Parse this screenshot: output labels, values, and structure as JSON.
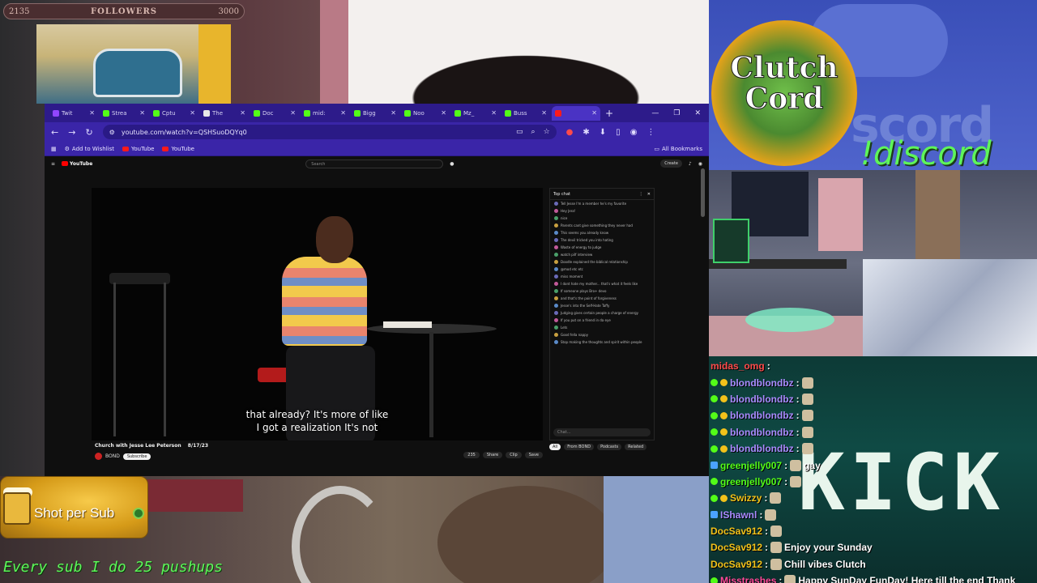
{
  "followers": {
    "current": "2135",
    "label": "FOLLOWERS",
    "goal": "3000"
  },
  "browser": {
    "tabs": [
      {
        "label": "Twit",
        "icon": "twitch-icon"
      },
      {
        "label": "Strea",
        "icon": "kick-icon"
      },
      {
        "label": "Cptu",
        "icon": "kick-icon"
      },
      {
        "label": "The",
        "icon": "shield-icon"
      },
      {
        "label": "Doc",
        "icon": "kick-icon"
      },
      {
        "label": "mid:",
        "icon": "kick-icon"
      },
      {
        "label": "Bigg",
        "icon": "kick-icon"
      },
      {
        "label": "Noo",
        "icon": "kick-icon"
      },
      {
        "label": "Mz_",
        "icon": "kick-icon"
      },
      {
        "label": "Buss",
        "icon": "kick-icon"
      },
      {
        "label": "",
        "icon": "youtube-icon"
      }
    ],
    "url": "youtube.com/watch?v=QSHSuoDQYq0",
    "bookmarks": [
      "Add to Wishlist",
      "YouTube",
      "YouTube"
    ],
    "all_bookmarks": "All Bookmarks"
  },
  "youtube": {
    "logo": "YouTube",
    "search_placeholder": "Search",
    "create": "Create",
    "subtitle_line1": "that already? It's more of like",
    "subtitle_line2": "I got a realization It's not",
    "video_title": "Church with Jesse Lee Peterson",
    "video_date": "8/17/23",
    "channel": "BOND",
    "subscribe": "Subscribe",
    "actions": [
      "235",
      "Share",
      "Clip",
      "Save"
    ],
    "chat_title": "Top chat",
    "chat_placeholder": "Chat...",
    "chips": [
      "All",
      "From BOND",
      "Podcasts",
      "Related"
    ],
    "chat_messages": [
      "Tell Jesse I'm a member he's my favorite",
      "Hey Jess!",
      "nice",
      "Parents cant give something they never had",
      "This seems you already know",
      "The devil tricked you into hating",
      "Waste of energy to judge",
      "watch pilf interview",
      "Doodle explained the biblical relationship",
      "@mod etc etc",
      "miss moment",
      "I dont hate my mother... that's what it feels like",
      "If someone plays Bro+ devo",
      "and that's the point of forgiveness",
      "Jesse's into the Self-Hate Taffy",
      "Judging gives certain people a charge of energy",
      "If you put on a friend in da eye",
      "Lets",
      "Good fella nappy",
      "Stop making the thoughts and spirit within people"
    ]
  },
  "discord": {
    "badge_line1": "Clutch",
    "badge_line2": "Cord",
    "command": "!discord",
    "bg_word": "scord"
  },
  "kick_chat": {
    "brand": "KICK",
    "messages": [
      {
        "user": "midas_omg",
        "text": "",
        "color": "#ff4a4a",
        "badge": ""
      },
      {
        "user": "blondblondbz",
        "text": "",
        "color": "#a98cff",
        "badge": "gy"
      },
      {
        "user": "blondblondbz",
        "text": "",
        "color": "#a98cff",
        "badge": "gy"
      },
      {
        "user": "blondblondbz",
        "text": "",
        "color": "#a98cff",
        "badge": "gy"
      },
      {
        "user": "blondblondbz",
        "text": "",
        "color": "#a98cff",
        "badge": "gy"
      },
      {
        "user": "blondblondbz",
        "text": "",
        "color": "#a98cff",
        "badge": "gy"
      },
      {
        "user": "greenjelly007",
        "text": "gay",
        "color": "#53fc18",
        "badge": "b"
      },
      {
        "user": "greenjelly007",
        "text": "",
        "color": "#53fc18",
        "badge": "g"
      },
      {
        "user": "Swizzy",
        "text": "",
        "color": "#f2c21a",
        "badge": "gy"
      },
      {
        "user": "IShawnl",
        "text": "",
        "color": "#a98cff",
        "badge": "b"
      },
      {
        "user": "DocSav912",
        "text": "",
        "color": "#f2c21a",
        "badge": ""
      },
      {
        "user": "DocSav912",
        "text": "Enjoy your Sunday",
        "color": "#f2c21a",
        "badge": ""
      },
      {
        "user": "DocSav912",
        "text": "Chill vibes Clutch",
        "color": "#f2c21a",
        "badge": ""
      },
      {
        "user": "Misstrashes",
        "text": "Happy SunDay FunDay! Here till the end Thank",
        "color": "#ff4a9a",
        "badge": "g"
      }
    ]
  },
  "overlays": {
    "shot_per_sub": "Shot per Sub",
    "pushups": "Every sub I do 25 pushups"
  }
}
